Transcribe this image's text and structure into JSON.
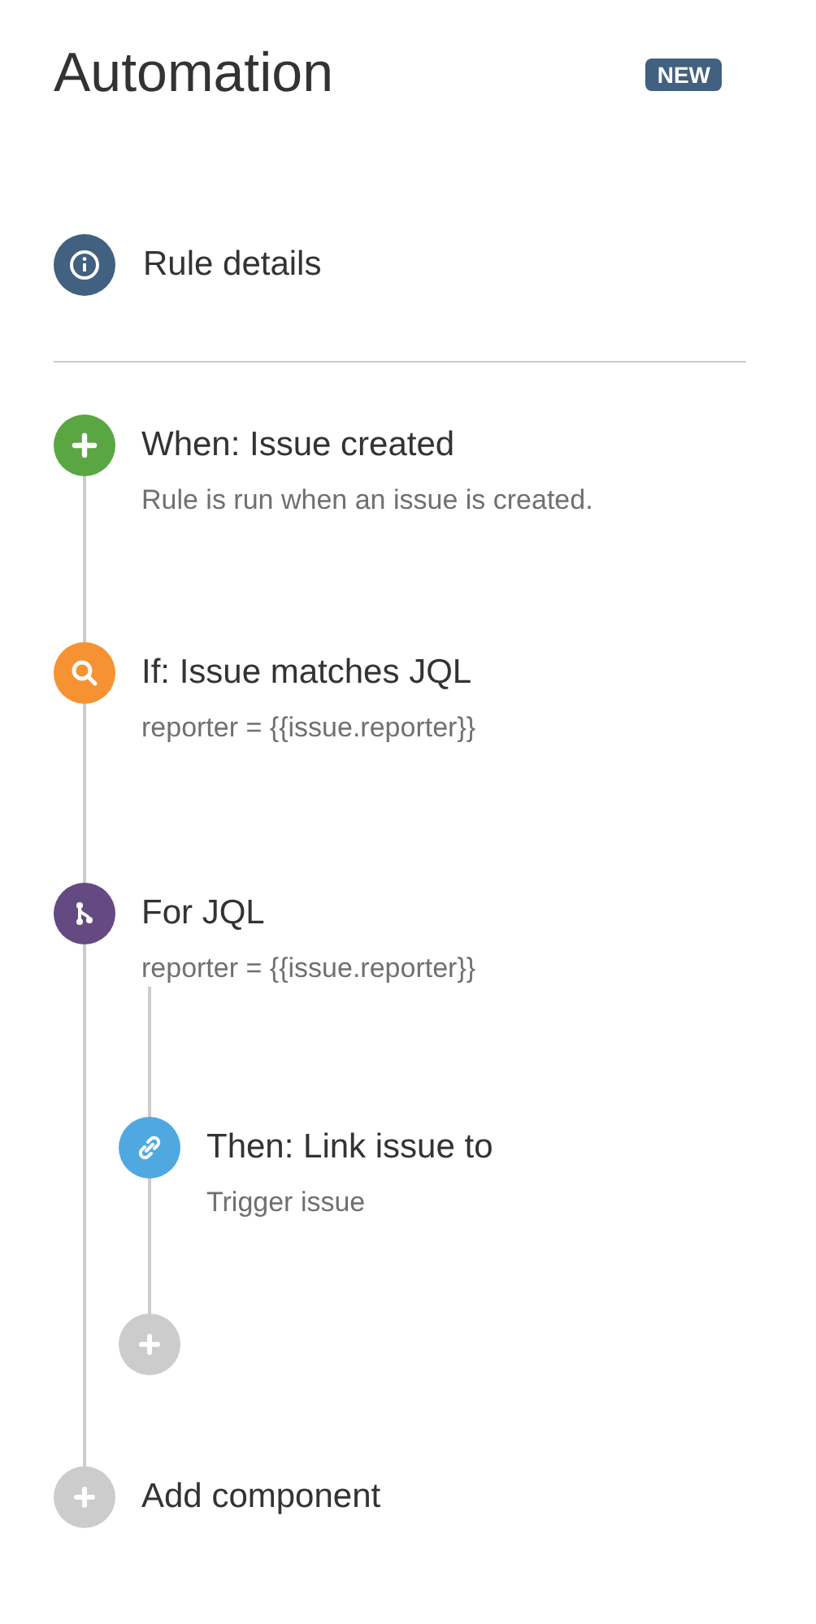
{
  "header": {
    "title": "Automation",
    "badge": "NEW"
  },
  "rule_details": {
    "label": "Rule details"
  },
  "steps": [
    {
      "kind": "trigger",
      "title": "When: Issue created",
      "description": "Rule is run when an issue is created."
    },
    {
      "kind": "condition",
      "title": "If: Issue matches JQL",
      "description": "reporter = {{issue.reporter}}"
    },
    {
      "kind": "branch",
      "title": "For JQL",
      "description": "reporter = {{issue.reporter}}",
      "children": [
        {
          "kind": "action",
          "title": "Then: Link issue to",
          "description": "Trigger issue"
        },
        {
          "kind": "add"
        }
      ]
    },
    {
      "kind": "add",
      "title": "Add component"
    }
  ]
}
